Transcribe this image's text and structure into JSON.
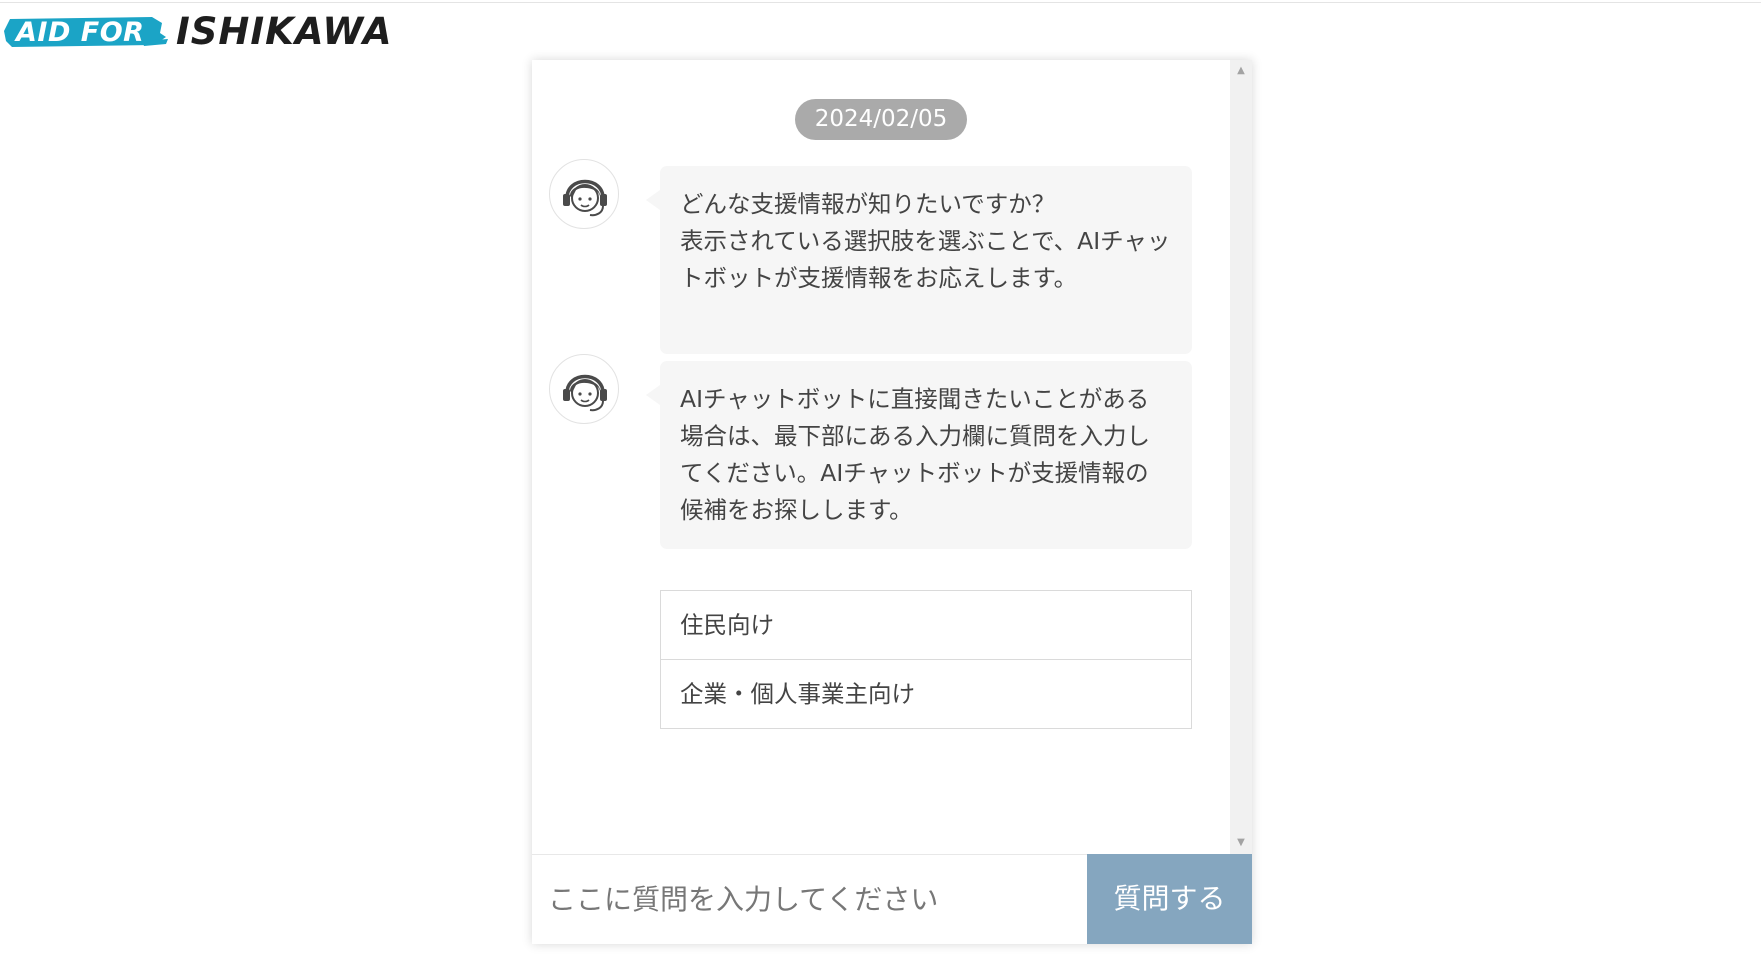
{
  "logo": {
    "left_text": "AID FOR",
    "right_text": "ISHIKAWA",
    "brush_color": "#1ba4c6"
  },
  "chat": {
    "date": "2024/02/05",
    "messages": [
      {
        "sender_icon": "operator-headset-icon",
        "text": "どんな支援情報が知りたいですか？\n表示されている選択肢を選ぶことで、AIチャットボットが支援情報をお応えします。"
      },
      {
        "sender_icon": "operator-headset-icon",
        "text": "AIチャットボットに直接聞きたいことがある場合は、最下部にある入力欄に質問を入力してください。AIチャットボットが支援情報の候補をお探しします。"
      }
    ],
    "options": [
      {
        "label": "住民向け"
      },
      {
        "label": "企業・個人事業主向け"
      }
    ]
  },
  "input": {
    "placeholder": "ここに質問を入力してください",
    "value": "",
    "submit_label": "質問する"
  },
  "colors": {
    "date_pill": "#aaaaaa",
    "bubble_bg": "#f6f6f6",
    "submit_button": "#85a6bf"
  }
}
